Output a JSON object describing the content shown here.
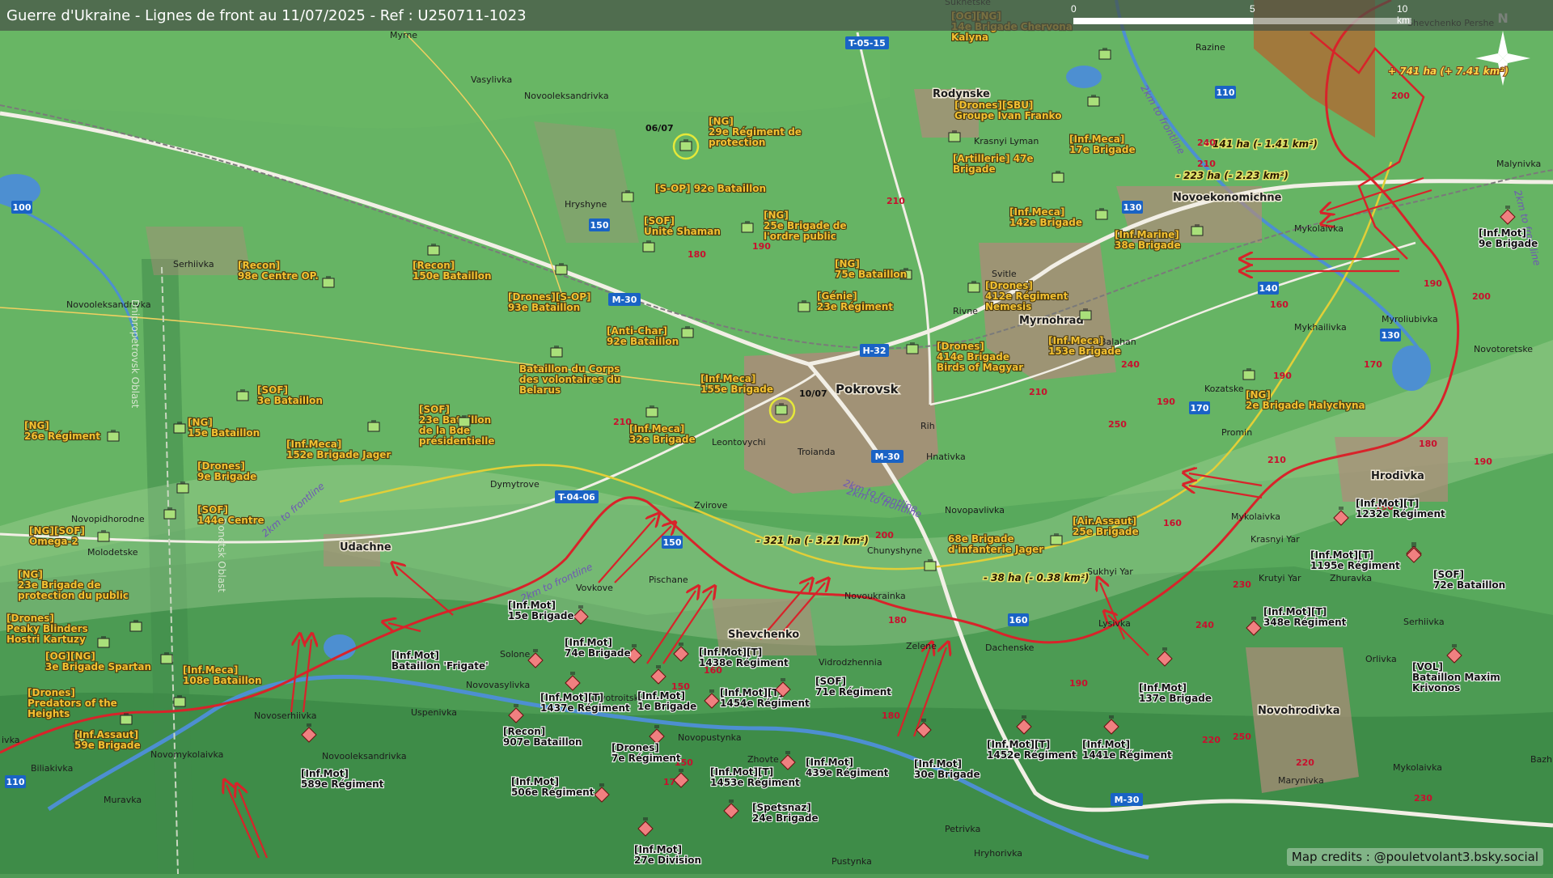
{
  "title": "Guerre d'Ukraine - Lignes de front au 11/07/2025 - Ref : U250711-1023",
  "credits": "Map credits : @pouletvolant3.bsky.social",
  "scale": {
    "ticks": [
      "0",
      "5",
      "10 km"
    ]
  },
  "compass": {
    "label": "N"
  },
  "colors": {
    "front_line": "#d8232a",
    "yellow_line": "#e2cf38",
    "road": "#f2efe6",
    "rail": "#7a7a7a",
    "river": "#4d8fd1",
    "unit_green": "#a9e07a",
    "unit_red": "#f08080",
    "unit_label": "#f4c232",
    "town_fill": "#b08a7a"
  },
  "towns": {
    "pokrovsk": "Pokrovsk",
    "myrnohrad": "Myrnohrad",
    "rodynske": "Rodynske",
    "novoekonomichne": "Novoekonomichne",
    "udachne": "Udachne",
    "shevchenko": "Shevchenko",
    "hrodivka": "Hrodivka",
    "novohrodivka": "Novohrodivka",
    "myrne": "Myrne",
    "vasylivka": "Vasylivka",
    "novooleksandrivka1": "Novooleksandrivka",
    "novooleksandrivka2": "Novooleksandrivka",
    "novooleksandrivka3": "Novooleksandrivka",
    "hryshyne": "Hryshyne",
    "serhiivka1": "Serhiivka",
    "serhiivka2": "Serhiivka",
    "krasnyi_lyman": "Krasnyi Lyman",
    "svitle": "Svitle",
    "rivne": "Rivne",
    "balahan": "Balahan",
    "kozatske": "Kozatske",
    "promin": "Promin",
    "mykolaivka1": "Mykolaivka",
    "mykolaivka2": "Mykolaivka",
    "mykolaivka3": "Mykolaivka",
    "mykhailivka": "Mykhailivka",
    "myroliubivka": "Myroliubivka",
    "novotoretske": "Novotoretske",
    "razine": "Razine",
    "malynivka": "Malynivka",
    "shevchenko_pershe": "Shevchenko Pershe",
    "sukhetske": "Sukhetske",
    "leontovychi": "Leontovychi",
    "troianda": "Troianda",
    "rih": "Rih",
    "hnativka": "Hnativka",
    "novopavlivka": "Novopavlivka",
    "dymytrove": "Dymytrove",
    "zvirove": "Zvirove",
    "novopidhorodne": "Novopidhorodne",
    "molodetske": "Molodetske",
    "vovkove": "Vovkove",
    "pischane": "Pischane",
    "novoukrainka": "Novoukrainka",
    "chunyshyne": "Chunyshyne",
    "sukhyi_yar": "Sukhyi Yar",
    "lysivka": "Lysivka",
    "dachenske": "Dachenske",
    "zelene": "Zelene",
    "vidrodzhennia": "Vidrodzhennia",
    "solone": "Solone",
    "novovasylivka": "Novovasylivka",
    "uspenivka": "Uspenivka",
    "novoserhiivka": "Novoserhiivka",
    "novomykolaivka": "Novomykolaivka",
    "biliakivka": "Biliakivka",
    "muravka": "Muravka",
    "novotroitske": "Novotroitske",
    "novopustynka": "Novopustynka",
    "zhovte": "Zhovte",
    "petrivka": "Petrivka",
    "hryhorivka": "Hryhorivka",
    "pustynka": "Pustynka",
    "krasnyi_yar": "Krasnyi Yar",
    "krutyi_yar": "Krutyi Yar",
    "zhuravka": "Zhuravka",
    "orlivka": "Orlivka",
    "marynivka": "Marynivka",
    "bazh": "Bazh",
    "ivka": "ivka"
  },
  "roads": {
    "t0515": "T-05-15",
    "m30a": "M-30",
    "h32": "H-32",
    "m30b": "M-30",
    "t0406": "T-04-06",
    "m30c": "M-30",
    "r110a": "110",
    "r110b": "110",
    "r130": "130",
    "r140": "140",
    "r150a": "150",
    "r150b": "150",
    "r100": "100",
    "r160": "160",
    "r170": "170",
    "r1130": "130"
  },
  "oblasts": {
    "dnipro": "Dnipropetrovsk Oblast",
    "donetsk": "Donetsk Oblast"
  },
  "distance_notes": {
    "a": "2km to frontline",
    "b": "2km to frontline",
    "c": "2km to frontline",
    "d": "2km to frontline",
    "e": "2km to frontline",
    "f": "2km to frontline"
  },
  "areas": {
    "a1": "+ 741 ha (+ 7.41 km²)",
    "a2": "- 141 ha (- 1.41 km²)",
    "a3": "- 223 ha (- 2.23 km²)",
    "a4": "- 321 ha (- 3.21 km²)",
    "a5": "- 38 ha (- 0.38 km²)"
  },
  "dates": {
    "d1": "06/07",
    "d2": "10/07"
  },
  "elev": {
    "e1": "210",
    "e2": "190",
    "e3": "180",
    "e4": "210",
    "e5": "240",
    "e6": "190",
    "e7": "200",
    "e8": "190",
    "e9": "170",
    "e10": "190",
    "e11": "240",
    "e12": "250",
    "e13": "210",
    "e14": "210",
    "e15": "200",
    "e16": "180",
    "e17": "160",
    "e18": "230",
    "e19": "240",
    "e20": "190",
    "e21": "220",
    "e22": "250",
    "e23": "220",
    "e24": "230",
    "e25": "180",
    "e26": "150",
    "e27": "160",
    "e28": "170",
    "e29": "150",
    "e30": "190",
    "e31": "200",
    "e32": "180",
    "e33": "160",
    "e34": "190",
    "e35": "210"
  },
  "units": {
    "u01": {
      "l1": "[OG][NG]",
      "l2": "14e Brigade Chervona",
      "l3": "Kalyna"
    },
    "u02": {
      "l1": "[Drones][SBU]",
      "l2": "Groupe Ivan Franko"
    },
    "u03": {
      "l1": "[NG]",
      "l2": "29e Régiment de",
      "l3": "protection"
    },
    "u04": {
      "l1": "[Inf.Meca]",
      "l2": "17e Brigade"
    },
    "u05": {
      "l1": "[Artillerie] 47e",
      "l2": "Brigade"
    },
    "u06": {
      "l1": "[S-OP] 92e Bataillon"
    },
    "u07": {
      "l1": "[SOF]",
      "l2": "Unité Shaman"
    },
    "u08": {
      "l1": "[NG]",
      "l2": "25e Brigade de",
      "l3": "l'ordre public"
    },
    "u09": {
      "l1": "[Inf.Meca]",
      "l2": "142e Brigade"
    },
    "u10": {
      "l1": "[Inf.Marine]",
      "l2": "38e Brigade"
    },
    "u11": {
      "l1": "[Recon]",
      "l2": "98e Centre OP."
    },
    "u12": {
      "l1": "[Recon]",
      "l2": "150e Bataillon"
    },
    "u13": {
      "l1": "[NG]",
      "l2": "75e Bataillon"
    },
    "u14": {
      "l1": "[Drones]",
      "l2": "412e Régiment",
      "l3": "Nemesis"
    },
    "u15": {
      "l1": "[Drones][S-OP]",
      "l2": "93e Bataillon"
    },
    "u16": {
      "l1": "[Génie]",
      "l2": "23e Régiment"
    },
    "u17": {
      "l1": "[Anti-Char]",
      "l2": "92e Bataillon"
    },
    "u18": {
      "l1": "[Drones]",
      "l2": "414e Brigade",
      "l3": "Birds of Magyar"
    },
    "u19": {
      "l1": "[Inf.Meca]",
      "l2": "153e Brigade"
    },
    "u20": {
      "l1": "Bataillon du Corps",
      "l2": "des volontaires du",
      "l3": "Belarus"
    },
    "u21": {
      "l1": "[Inf.Meca]",
      "l2": "155e Brigade"
    },
    "u22": {
      "l1": "[SOF]",
      "l2": "3e Bataillon"
    },
    "u23": {
      "l1": "[SOF]",
      "l2": "23e Bataillon",
      "l3": "de la Bde",
      "l4": "présidentielle"
    },
    "u24": {
      "l1": "[Inf.Meca]",
      "l2": "32e Brigade"
    },
    "u25": {
      "l1": "[NG]",
      "l2": "26e Régiment"
    },
    "u26": {
      "l1": "[NG]",
      "l2": "15e Bataillon"
    },
    "u27": {
      "l1": "[Inf.Meca]",
      "l2": "152e Brigade Jager"
    },
    "u28": {
      "l1": "[NG]",
      "l2": "2e Brigade Halychyna"
    },
    "u29": {
      "l1": "[Drones]",
      "l2": "9e Brigade"
    },
    "u30": {
      "l1": "[SOF]",
      "l2": "144e Centre"
    },
    "u31": {
      "l1": "[NG][SOF]",
      "l2": "Omega-2"
    },
    "u32": {
      "l1": "[Air.Assaut]",
      "l2": "25e Brigade"
    },
    "u33": {
      "l1": "68e Brigade",
      "l2": "d'infanterie Jager"
    },
    "u34": {
      "l1": "[NG]",
      "l2": "23e Brigade de",
      "l3": "protection du public"
    },
    "u35": {
      "l1": "[Drones]",
      "l2": "Peaky Blinders",
      "l3": "Hostri Kartuzy"
    },
    "u36": {
      "l1": "[OG][NG]",
      "l2": "3e Brigade Spartan"
    },
    "u37": {
      "l1": "[Inf.Meca]",
      "l2": "108e Bataillon"
    },
    "u38": {
      "l1": "[Drones]",
      "l2": "Predators of the",
      "l3": "Heights"
    },
    "u39": {
      "l1": "[Inf.Assaut]",
      "l2": "59e Brigade"
    }
  },
  "enemy": {
    "r01": {
      "l1": "[Inf.Mot]",
      "l2": "9e Brigade"
    },
    "r02": {
      "l1": "[Inf.Mot][T]",
      "l2": "1232e Régiment"
    },
    "r03": {
      "l1": "[Inf.Mot][T]",
      "l2": "1195e Régiment"
    },
    "r04": {
      "l1": "[SOF]",
      "l2": "72e Bataillon"
    },
    "r05": {
      "l1": "[Inf.Mot][T]",
      "l2": "348e Régiment"
    },
    "r06": {
      "l1": "[VOL]",
      "l2": "Bataillon Maxim",
      "l3": "Krivonos"
    },
    "r07": {
      "l1": "[Inf.Mot]",
      "l2": "15e Brigade"
    },
    "r08": {
      "l1": "[Inf.Mot]",
      "l2": "74e Brigade"
    },
    "r09": {
      "l1": "[Inf.Mot][T]",
      "l2": "1438e Régiment"
    },
    "r10": {
      "l1": "[Inf.Mot]",
      "l2": "Bataillon 'Frigate'"
    },
    "r11": {
      "l1": "[Inf.Mot][T]",
      "l2": "1437e Régiment"
    },
    "r12": {
      "l1": "[Inf.Mot]",
      "l2": "1e Brigade"
    },
    "r13": {
      "l1": "[Inf.Mot][T]",
      "l2": "1454e Régiment"
    },
    "r14": {
      "l1": "[SOF]",
      "l2": "71e Régiment"
    },
    "r15": {
      "l1": "[Inf.Mot]",
      "l2": "137e Brigade"
    },
    "r16": {
      "l1": "[Recon]",
      "l2": "907e Bataillon"
    },
    "r17": {
      "l1": "[Drones]",
      "l2": "7e Régiment"
    },
    "r18": {
      "l1": "[Inf.Mot]",
      "l2": "589e Régiment"
    },
    "r19": {
      "l1": "[Inf.Mot]",
      "l2": "30e Brigade"
    },
    "r20": {
      "l1": "[Inf.Mot][T]",
      "l2": "1452e Régiment"
    },
    "r21": {
      "l1": "[Inf.Mot]",
      "l2": "1441e Régiment"
    },
    "r22": {
      "l1": "[Inf.Mot]",
      "l2": "439e Régiment"
    },
    "r23": {
      "l1": "[Inf.Mot][T]",
      "l2": "1453e Régiment"
    },
    "r24": {
      "l1": "[Inf.Mot]",
      "l2": "506e Régiment"
    },
    "r25": {
      "l1": "[Spetsnaz]",
      "l2": "24e Brigade"
    },
    "r26": {
      "l1": "[Inf.Mot]",
      "l2": "27e Division"
    }
  }
}
